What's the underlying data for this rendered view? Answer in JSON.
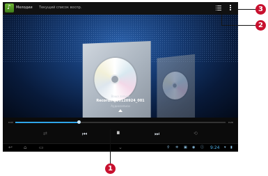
{
  "actionbar": {
    "app_title": "Мелодии",
    "subtitle": "Текущий список воспр.",
    "app_icon": "music-note-icon",
    "menu_list_icon": "list-menu-icon",
    "overflow_icon": "overflow-menu-icon"
  },
  "now_playing": {
    "label": "Ваша запись",
    "track": "Recording20120924_001",
    "artist": "Аудиозаписи"
  },
  "playback": {
    "time_start": "0:03",
    "time_end": "0:20",
    "progress": 0.3,
    "accent": "#2fa5e8"
  },
  "controls": {
    "shuffle": "⇄",
    "prev": "⏮",
    "pause": "⏸",
    "next": "⏭",
    "repeat": "⟲"
  },
  "navbar": {
    "back": "↩",
    "home": "⌂",
    "recent": "▭",
    "hide": "⌄",
    "clock": "9:24"
  },
  "callouts": {
    "c1": "1",
    "c2": "2",
    "c3": "3",
    "color": "#c8102e"
  }
}
